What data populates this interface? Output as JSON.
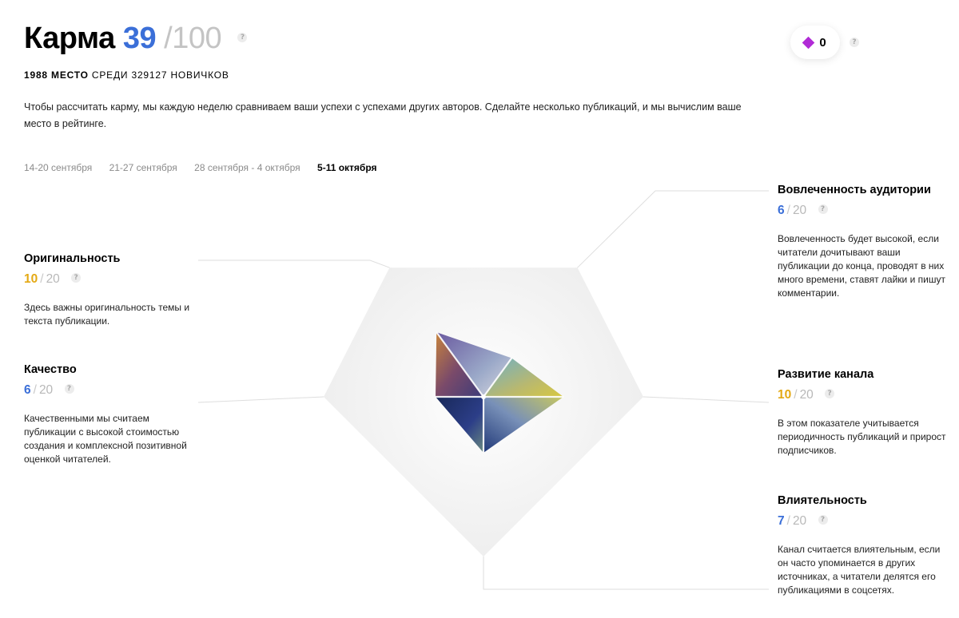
{
  "header": {
    "title": "Карма",
    "karma_value": "39",
    "karma_max": "/100",
    "rank_place": "1988 место",
    "rank_rest": "среди 329127 новичков",
    "description": "Чтобы рассчитать карму, мы каждую неделю сравниваем ваши успехи с успехами других авторов. Сделайте несколько публикаций, и мы вычислим ваше место в рейтинге.",
    "help_icon": "?"
  },
  "badge": {
    "icon": "diamond-icon",
    "count": "0",
    "color": "#b12bd6"
  },
  "weeks": [
    {
      "label": "14-20 сентября",
      "active": false
    },
    {
      "label": "21-27 сентября",
      "active": false
    },
    {
      "label": "28 сентября - 4 октября",
      "active": false
    },
    {
      "label": "5-11 октября",
      "active": true
    }
  ],
  "metrics": {
    "originality": {
      "title": "Оригинальность",
      "value": "10",
      "max": "20",
      "color": "#e4a914",
      "description": "Здесь важны оригинальность темы и текста публикации."
    },
    "quality": {
      "title": "Качество",
      "value": "6",
      "max": "20",
      "color": "#3b6fd8",
      "description": "Качественными мы считаем публикации с высокой стоимостью создания и комплексной позитивной оценкой читателей."
    },
    "engagement": {
      "title": "Вовлеченность аудитории",
      "value": "6",
      "max": "20",
      "color": "#3b6fd8",
      "description": "Вовлеченность будет высокой, если читатели дочитывают ваши публикации до конца, проводят в них много времени, ставят лайки и пишут комментарии."
    },
    "growth": {
      "title": "Развитие канала",
      "value": "10",
      "max": "20",
      "color": "#e4a914",
      "description": "В этом показателе учитывается периодичность публикаций и прирост подписчиков."
    },
    "influence": {
      "title": "Влиятельность",
      "value": "7",
      "max": "20",
      "color": "#3b6fd8",
      "description": "Канал считается влиятельным, если он часто упоминается в других источниках, а читатели делятся его публикациями в соцсетях."
    }
  },
  "chart_data": {
    "type": "radar",
    "max": 20,
    "axes": [
      "Оригинальность",
      "Вовлеченность аудитории",
      "Развитие канала",
      "Влиятельность",
      "Качество"
    ],
    "values": [
      10,
      6,
      10,
      7,
      6
    ]
  }
}
